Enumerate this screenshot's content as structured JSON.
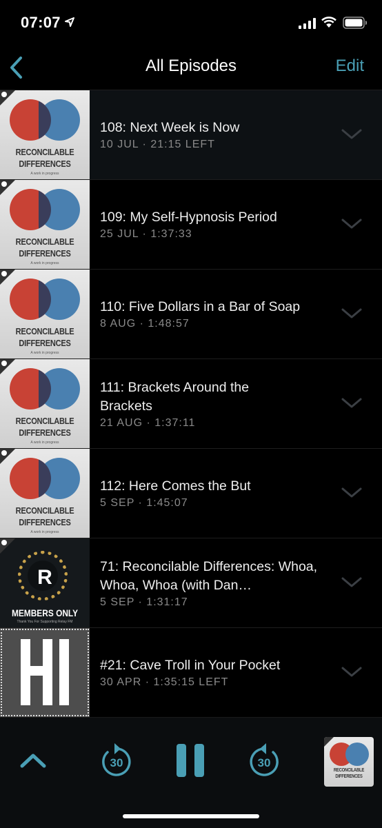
{
  "status_bar": {
    "time": "07:07"
  },
  "nav": {
    "title": "All Episodes",
    "edit": "Edit"
  },
  "episodes": [
    {
      "title": "108: Next Week is Now",
      "meta": "10 JUL · 21:15 LEFT",
      "art": "reconcilable-differences"
    },
    {
      "title": "109: My Self-Hypnosis Period",
      "meta": "25 JUL · 1:37:33",
      "art": "reconcilable-differences"
    },
    {
      "title": "110: Five Dollars in a Bar of Soap",
      "meta": "8 AUG · 1:48:57",
      "art": "reconcilable-differences"
    },
    {
      "title": "111: Brackets Around the Brackets",
      "meta": "21 AUG · 1:37:11",
      "art": "reconcilable-differences"
    },
    {
      "title": "112: Here Comes the But",
      "meta": "5 SEP · 1:45:07",
      "art": "reconcilable-differences"
    },
    {
      "title": "71: Reconcilable Differences: Whoa, Whoa, Whoa (with Dan…",
      "meta": "5 SEP · 1:31:17",
      "art": "members-only"
    },
    {
      "title": "#21: Cave Troll in Your Pocket",
      "meta": "30 APR · 1:35:15 LEFT",
      "art": "hi"
    }
  ],
  "artwork": {
    "rd_line1": "RECONCILABLE",
    "rd_line2": "DIFFERENCES",
    "rd_tagline": "A work in progress",
    "mo_letter": "R",
    "mo_title": "MEMBERS ONLY",
    "mo_tagline": "Thank You For Supporting Relay FM",
    "hi_text": "HI"
  },
  "player": {
    "skip_back_seconds": "30",
    "skip_forward_seconds": "30"
  },
  "colors": {
    "accent": "#4a9fb5",
    "background": "#000000"
  }
}
